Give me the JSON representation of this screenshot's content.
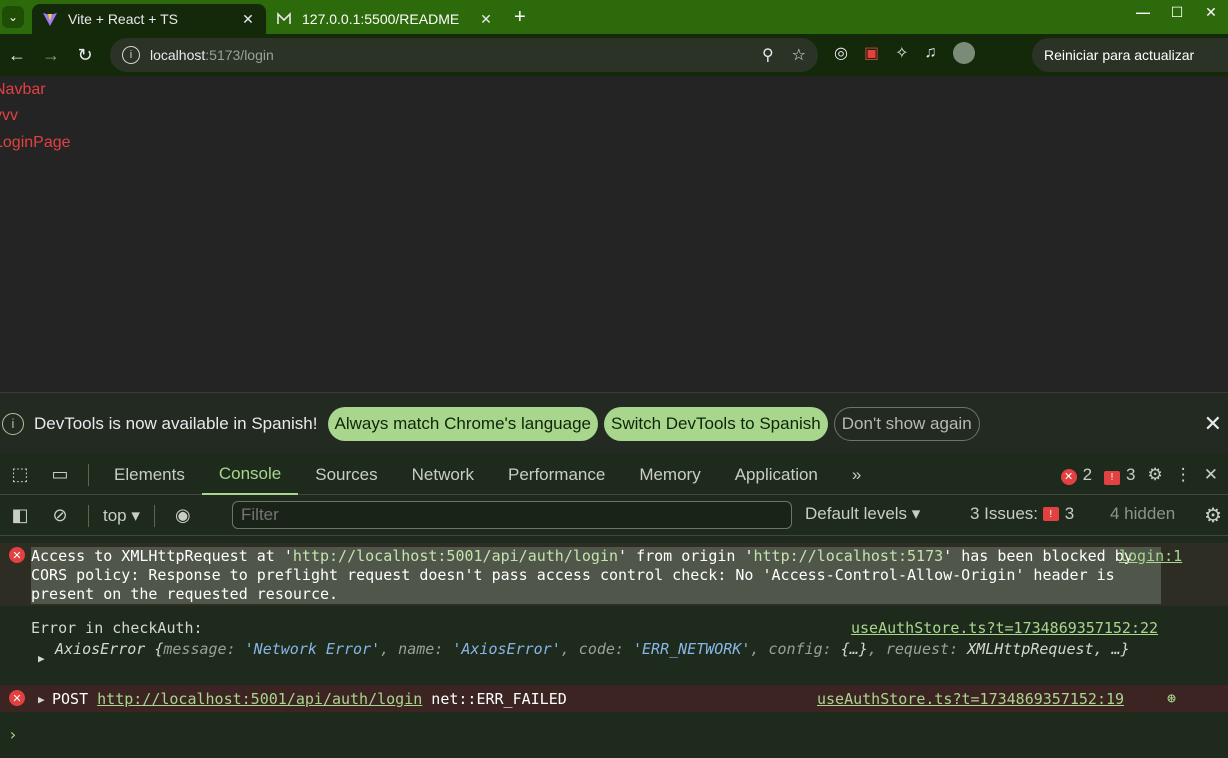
{
  "browser": {
    "tabs": [
      {
        "title": "Vite + React + TS",
        "active": true
      },
      {
        "title": "127.0.0.1:5500/README",
        "active": false
      }
    ],
    "address": {
      "host": "localhost",
      "path": ":5173/login"
    },
    "relaunch_label": "Reiniciar para actualizar"
  },
  "page": {
    "lines": [
      "Navbar",
      "vvv",
      "LoginPage"
    ]
  },
  "infobar": {
    "message": "DevTools is now available in Spanish!",
    "btn_match": "Always match Chrome's language",
    "btn_switch": "Switch DevTools to Spanish",
    "btn_dont_show": "Don't show again"
  },
  "devtools": {
    "tabs": [
      "Elements",
      "Console",
      "Sources",
      "Network",
      "Performance",
      "Memory",
      "Application"
    ],
    "active_tab": "Console",
    "error_count": "2",
    "issue_count": "3",
    "toolbar": {
      "context": "top",
      "filter_placeholder": "Filter",
      "levels": "Default levels",
      "issues_label": "3 Issues:",
      "issues_badge": "3",
      "hidden": "4 hidden"
    },
    "console": {
      "cors_error": {
        "p1": "Access to XMLHttpRequest at '",
        "url1": "http://localhost:5001/api/auth/login",
        "p2": "' from origin '",
        "url2": "http://localhost:5173",
        "p3": "' has been blocked by CORS policy: Response to preflight request doesn't pass access control check: No 'Access-Control-Allow-Origin' header is present on the requested resource.",
        "source": "login:1"
      },
      "checkauth": {
        "text": "Error in checkAuth:",
        "source": "useAuthStore.ts?t=1734869357152:22",
        "obj_name": "AxiosError",
        "k_message": "message: ",
        "v_message": "'Network Error'",
        "k_name": ", name: ",
        "v_name": "'AxiosError'",
        "k_code": ", code: ",
        "v_code": "'ERR_NETWORK'",
        "k_config": ", config: ",
        "v_config": "{…}",
        "k_request": ", request: ",
        "v_request": "XMLHttpRequest, …}"
      },
      "post_error": {
        "method": "POST",
        "url": "http://localhost:5001/api/auth/login",
        "status": "net::ERR_FAILED",
        "source": "useAuthStore.ts?t=1734869357152:19"
      }
    }
  }
}
